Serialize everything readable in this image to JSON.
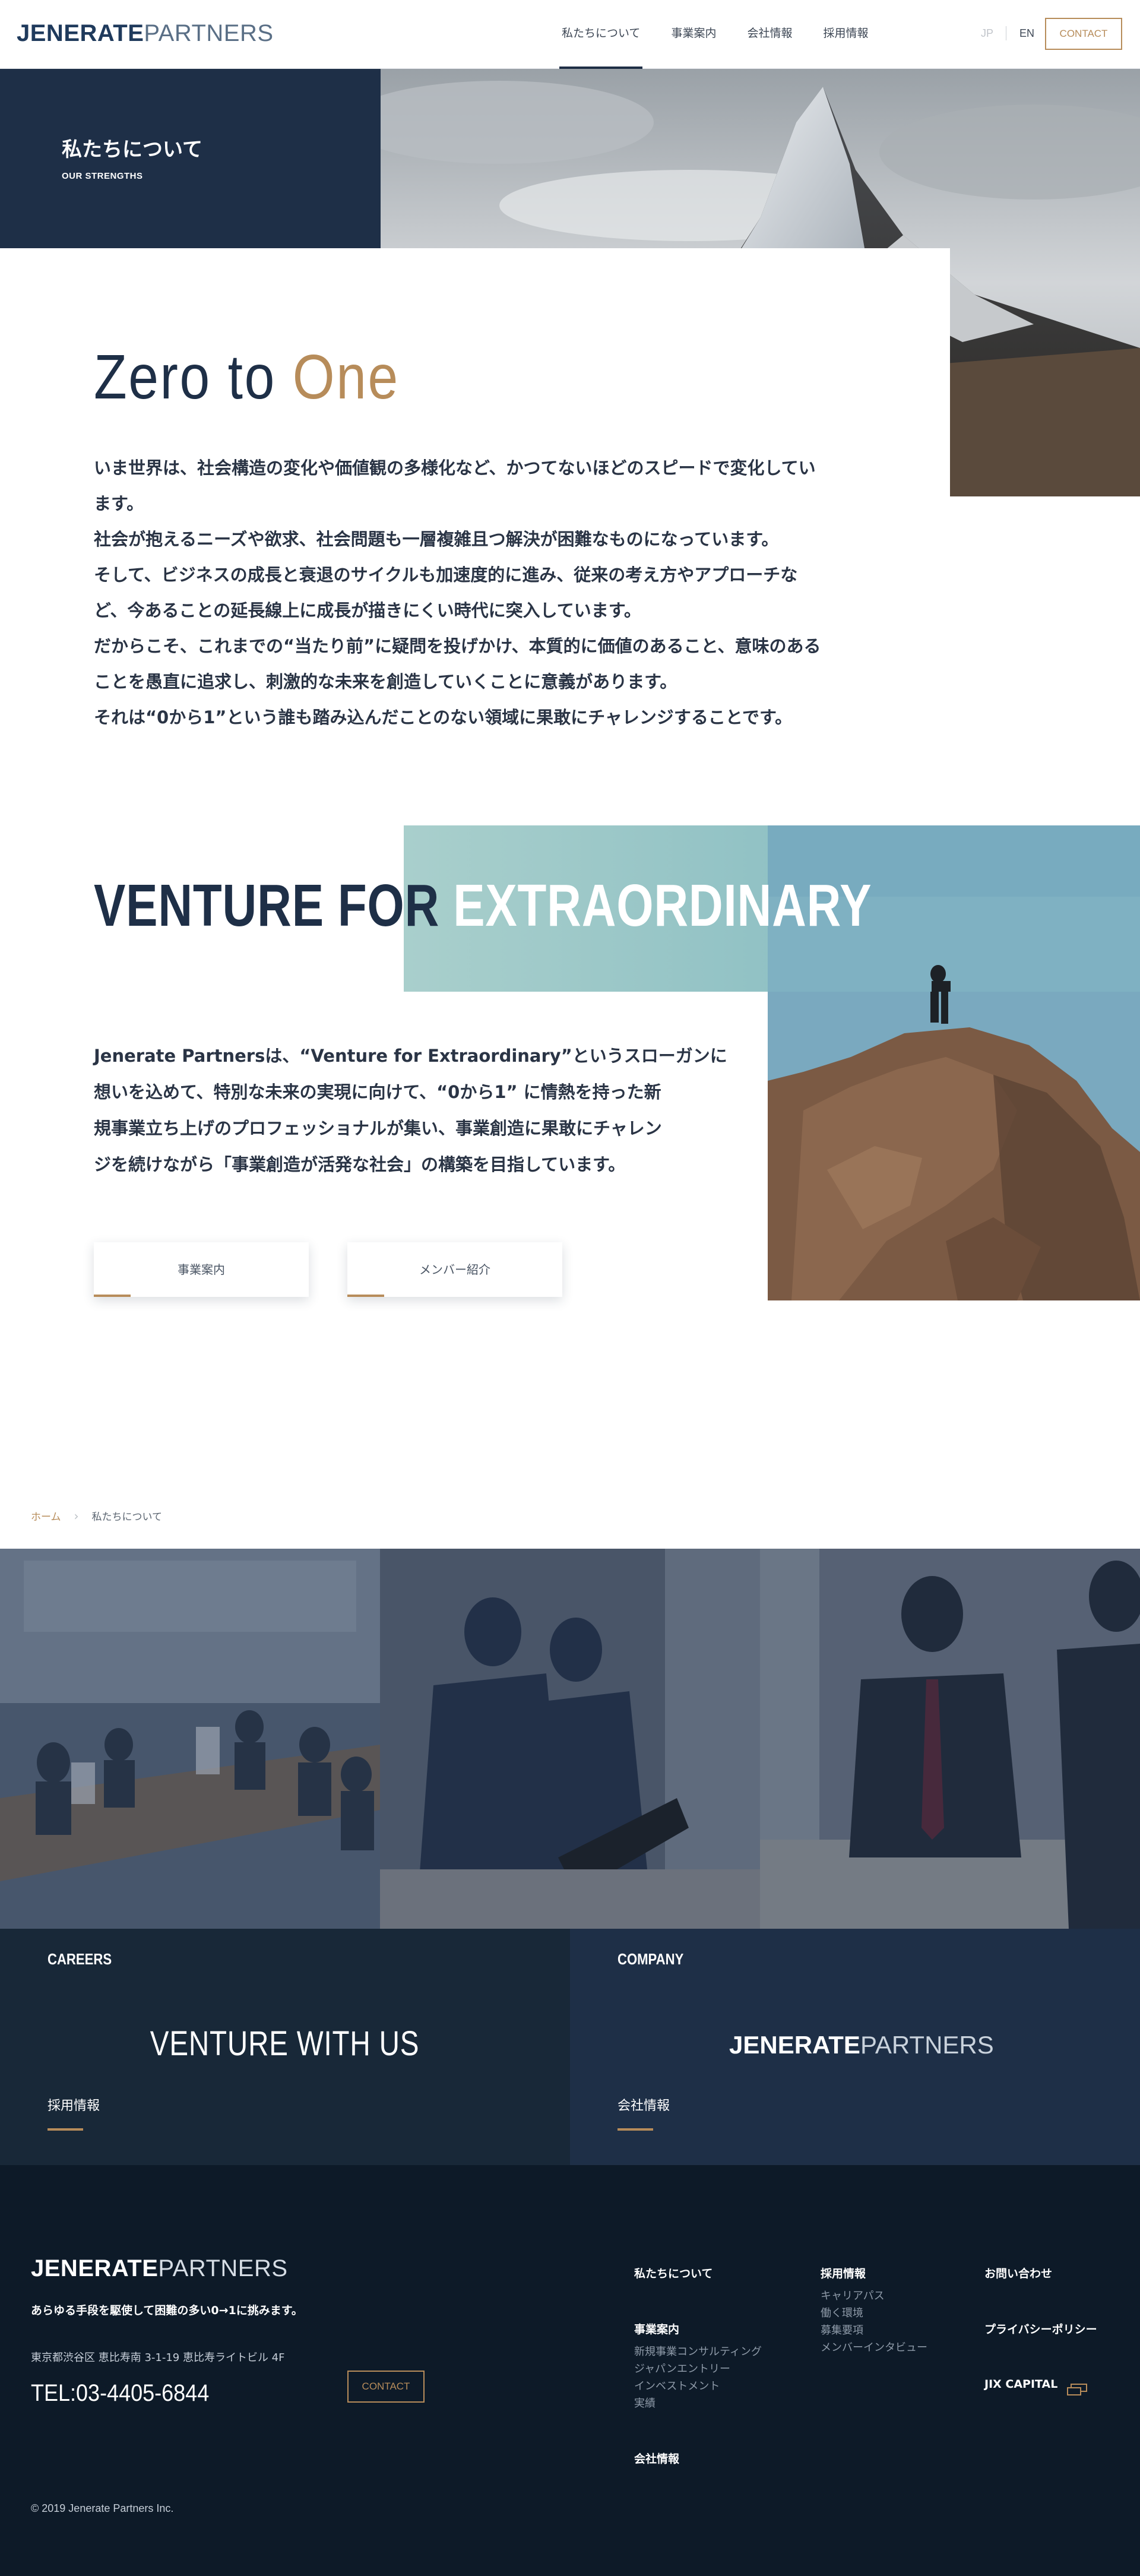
{
  "header": {
    "logo_bold": "JENERATE",
    "logo_light": "PARTNERS",
    "nav": [
      "私たちについて",
      "事業案内",
      "会社情報",
      "採用情報"
    ],
    "lang_jp": "JP",
    "lang_en": "EN",
    "contact": "CONTACT"
  },
  "hero": {
    "title": "私たちについて",
    "subtitle": "OUR STRENGTHS"
  },
  "intro": {
    "title_main": "Zero to ",
    "title_accent": "One",
    "lines": [
      "いま世界は、社会構造の変化や価値観の多様化など、かつてないほどのスピードで変化してい",
      "ます。",
      "社会が抱えるニーズや欲求、社会問題も一層複雑且つ解決が困難なものになっています。",
      "そして、ビジネスの成長と衰退のサイクルも加速度的に進み、従来の考え方やアプローチな",
      "ど、今あることの延長線上に成長が描きにくい時代に突入しています。",
      "だからこそ、これまでの“当たり前”に疑問を投げかけ、本質的に価値のあること、意味のある",
      "ことを愚直に追求し、刺激的な未来を創造していくことに意義があります。",
      "それは“0から1”という誰も踏み込んだことのない領域に果敢にチャレンジすることです。"
    ]
  },
  "venture": {
    "title_dark": "VENTURE FOR ",
    "title_light": "EXTRAORDINARY",
    "lines": [
      "Jenerate Partnersは、“Venture for Extraordinary”というスローガンに",
      "想いを込めて、特別な未来の実現に向けて、“0から1” に情熱を持った新",
      "規事業立ち上げのプロフェッショナルが集い、事業創造に果敢にチャレン",
      "ジを続けながら「事業創造が活発な社会」の構築を目指しています。"
    ],
    "button_business": "事業案内",
    "button_members": "メンバー紹介"
  },
  "breadcrumb": {
    "home": "ホーム",
    "current": "私たちについて"
  },
  "banners": {
    "careers_label": "CAREERS",
    "careers_title": "VENTURE WITH US",
    "careers_link": "採用情報",
    "company_label": "COMPANY",
    "company_logo_bold": "JENERATE",
    "company_logo_light": "PARTNERS",
    "company_link": "会社情報"
  },
  "footer": {
    "logo_bold": "JENERATE",
    "logo_light": "PARTNERS",
    "tagline": "あらゆる手段を駆使して困難の多い0→1に挑みます。",
    "address": "東京都渋谷区 恵比寿南 3-1-19 恵比寿ライトビル 4F",
    "tel": "TEL:03-4405-6844",
    "contact": "CONTACT",
    "about": "私たちについて",
    "business": "事業案内",
    "business_items": [
      "新規事業コンサルティング",
      "ジャパンエントリー",
      "インベストメント",
      "実績"
    ],
    "company": "会社情報",
    "recruit": "採用情報",
    "recruit_items": [
      "キャリアパス",
      "働く環境",
      "募集要項",
      "メンバーインタビュー"
    ],
    "inquiry": "お問い合わせ",
    "privacy": "プライバシーポリシー",
    "jix": "JIX CAPITAL",
    "copyright": "© 2019 Jenerate Partners Inc."
  },
  "colors": {
    "navy": "#1e2f47",
    "gold": "#b78c5a",
    "footer_bg": "#0d1a28"
  }
}
